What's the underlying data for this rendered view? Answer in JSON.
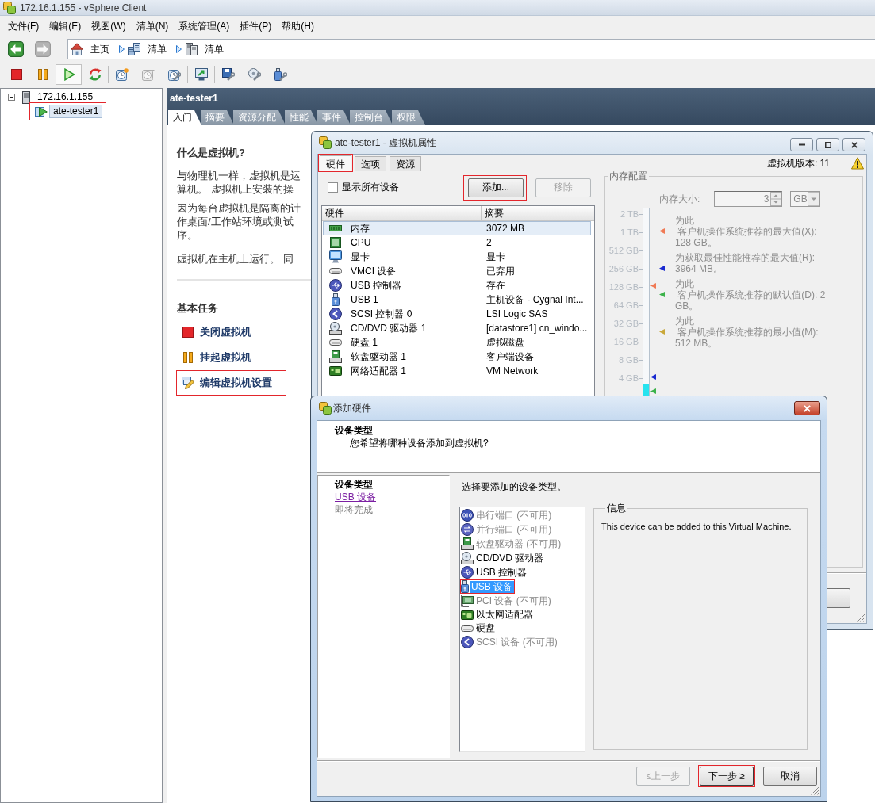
{
  "window": {
    "title": "172.16.1.155 - vSphere Client"
  },
  "menu": [
    "文件(F)",
    "编辑(E)",
    "视图(W)",
    "清单(N)",
    "系统管理(A)",
    "插件(P)",
    "帮助(H)"
  ],
  "navigation": {
    "back": {
      "disabled": false
    },
    "forward": {
      "disabled": true
    },
    "breadcrumbs": [
      {
        "kind": "home",
        "label": "主页"
      },
      {
        "kind": "inventory",
        "label": "清单"
      },
      {
        "kind": "hosts",
        "label": "清单"
      }
    ]
  },
  "toolbar": [
    [
      {
        "kind": "stop",
        "disabled": false,
        "pressed": false
      },
      {
        "kind": "pause",
        "disabled": false,
        "pressed": false
      },
      {
        "kind": "play",
        "disabled": false,
        "pressed": true
      },
      {
        "kind": "reset",
        "disabled": false,
        "pressed": false
      }
    ],
    [
      {
        "kind": "snapshot",
        "disabled": false,
        "pressed": false
      },
      {
        "kind": "revert",
        "disabled": true,
        "pressed": false
      },
      {
        "kind": "snapshot_manager",
        "disabled": false,
        "pressed": false
      }
    ],
    [
      {
        "kind": "console",
        "disabled": false,
        "pressed": false
      }
    ],
    [
      {
        "kind": "edit_settings",
        "disabled": false,
        "pressed": false
      },
      {
        "kind": "cd_settings",
        "disabled": false,
        "pressed": false
      },
      {
        "kind": "usb_settings",
        "disabled": false,
        "pressed": false
      }
    ]
  ],
  "inventory_tree": [
    {
      "kind": "host",
      "label": "172.16.1.155",
      "expanded": true,
      "selected": false,
      "highlighted": false,
      "children": [
        {
          "kind": "vm",
          "label": "ate-tester1",
          "selected": true,
          "highlighted": true
        }
      ]
    }
  ],
  "vm_panel": {
    "title": "ate-tester1",
    "tabs": [
      {
        "label": "入门",
        "selected": true
      },
      {
        "label": "摘要",
        "selected": false
      },
      {
        "label": "资源分配",
        "selected": false
      },
      {
        "label": "性能",
        "selected": false
      },
      {
        "label": "事件",
        "selected": false
      },
      {
        "label": "控制台",
        "selected": false
      },
      {
        "label": "权限",
        "selected": false
      }
    ],
    "heading": "什么是虚拟机?",
    "paragraphs": [
      [
        "与物理机一样，虚拟机是运",
        "算机。 虚拟机上安装的操"
      ],
      [
        "因为每台虚拟机是隔离的计",
        "作桌面/工作站环境或测试",
        "序。"
      ],
      [
        "虚拟机在主机上运行。 同"
      ]
    ],
    "tasks_heading": "基本任务",
    "tasks": [
      {
        "kind": "power_off",
        "label": "关闭虚拟机",
        "highlighted": false
      },
      {
        "kind": "suspend",
        "label": "挂起虚拟机",
        "highlighted": false
      },
      {
        "kind": "edit",
        "label": "编辑虚拟机设置",
        "highlighted": true
      }
    ]
  },
  "properties_dialog": {
    "title": "ate-tester1 - 虚拟机属性",
    "tabs": [
      {
        "label": "硬件",
        "selected": true,
        "highlighted": true
      },
      {
        "label": "选项",
        "selected": false,
        "highlighted": false
      },
      {
        "label": "资源",
        "selected": false,
        "highlighted": false
      }
    ],
    "version": "虚拟机版本: 11",
    "warning": true,
    "show_all_devices": {
      "label": "显示所有设备",
      "checked": false
    },
    "buttons": [
      {
        "label": "添加...",
        "disabled": false,
        "highlighted": true
      },
      {
        "label": "移除",
        "disabled": true,
        "highlighted": false
      }
    ],
    "table": {
      "columns": [
        "硬件",
        "摘要"
      ],
      "rows": [
        {
          "kind": "memory",
          "name": "内存",
          "summary": "3072 MB",
          "selected": true
        },
        {
          "kind": "cpu",
          "name": "CPU",
          "summary": "2",
          "selected": false
        },
        {
          "kind": "display",
          "name": "显卡",
          "summary": "显卡",
          "selected": false
        },
        {
          "kind": "vmci",
          "name": "VMCI 设备",
          "summary": "已弃用",
          "selected": false
        },
        {
          "kind": "usb_controller",
          "name": "USB 控制器",
          "summary": "存在",
          "selected": false
        },
        {
          "kind": "usb",
          "name": "USB 1",
          "summary": "主机设备 - Cygnal Int...",
          "selected": false
        },
        {
          "kind": "scsi",
          "name": "SCSI 控制器 0",
          "summary": "LSI Logic SAS",
          "selected": false
        },
        {
          "kind": "cdrom",
          "name": "CD/DVD 驱动器 1",
          "summary": "[datastore1] cn_windo...",
          "selected": false
        },
        {
          "kind": "disk",
          "name": "硬盘 1",
          "summary": "虚拟磁盘",
          "selected": false
        },
        {
          "kind": "floppy",
          "name": "软盘驱动器 1",
          "summary": "客户端设备",
          "selected": false
        },
        {
          "kind": "network",
          "name": "网络适配器 1",
          "summary": "VM Network",
          "selected": false
        }
      ]
    },
    "memory": {
      "title": "内存配置",
      "disabled": true,
      "size_label": "内存大小:",
      "size_value": "3",
      "unit": "GB",
      "level": 0.5,
      "ticks": [
        "2 TB",
        "1 TB",
        "512 GB",
        "256 GB",
        "128 GB",
        "64 GB",
        "32 GB",
        "16 GB",
        "8 GB",
        "4 GB"
      ],
      "scale_markers": [
        {
          "color": "#f07a55",
          "level": 0.78
        },
        {
          "color": "#1a2ad0",
          "level": 0.52
        },
        {
          "color": "#3cb24a",
          "level": 0.48
        }
      ],
      "legend": [
        {
          "color": "#f07a55",
          "lines": [
            "为此",
            " 客户机操作系统推荐的最大值(X):",
            "128 GB。"
          ]
        },
        {
          "color": "#1a2ad0",
          "lines": [
            "为获取最佳性能推荐的最大值(R):",
            "3964 MB。"
          ]
        },
        {
          "color": "#3cb24a",
          "lines": [
            "为此",
            " 客户机操作系统推荐的默认值(D): 2",
            "GB。"
          ]
        },
        {
          "color": "#c9a83a",
          "lines": [
            "为此",
            " 客户机操作系统推荐的最小值(M):",
            "512 MB。"
          ]
        }
      ]
    }
  },
  "add_hardware_dialog": {
    "title": "添加硬件",
    "heading": "设备类型",
    "subtitle": "您希望将哪种设备添加到虚拟机?",
    "steps": [
      {
        "label": "设备类型",
        "selected": true,
        "disabled": false
      },
      {
        "label": "USB 设备",
        "selected": false,
        "disabled": false
      },
      {
        "label": "即将完成",
        "selected": false,
        "disabled": true
      }
    ],
    "prompt": "选择要添加的设备类型。",
    "devices": [
      {
        "kind": "serial",
        "label": "串行端口 (不可用)",
        "disabled": true,
        "selected": false,
        "highlighted": false
      },
      {
        "kind": "parallel",
        "label": "并行端口 (不可用)",
        "disabled": true,
        "selected": false,
        "highlighted": false
      },
      {
        "kind": "floppy",
        "label": "软盘驱动器 (不可用)",
        "disabled": true,
        "selected": false,
        "highlighted": false
      },
      {
        "kind": "cdrom",
        "label": "CD/DVD 驱动器",
        "disabled": false,
        "selected": false,
        "highlighted": false
      },
      {
        "kind": "usb_controller",
        "label": "USB 控制器",
        "disabled": false,
        "selected": false,
        "highlighted": false
      },
      {
        "kind": "usb",
        "label": "USB 设备",
        "disabled": false,
        "selected": true,
        "highlighted": true
      },
      {
        "kind": "pci",
        "label": "PCI 设备 (不可用)",
        "disabled": true,
        "selected": false,
        "highlighted": false
      },
      {
        "kind": "network",
        "label": "以太网适配器",
        "disabled": false,
        "selected": false,
        "highlighted": false
      },
      {
        "kind": "disk",
        "label": "硬盘",
        "disabled": false,
        "selected": false,
        "highlighted": false
      },
      {
        "kind": "scsi",
        "label": "SCSI 设备 (不可用)",
        "disabled": true,
        "selected": false,
        "highlighted": false
      }
    ],
    "info": {
      "title": "信息",
      "text": "This device can be added to this Virtual Machine."
    },
    "buttons": [
      {
        "label": "≤上一步",
        "disabled": true,
        "default": false,
        "highlighted": false
      },
      {
        "label": "下一步 ≥",
        "disabled": false,
        "default": true,
        "highlighted": true
      },
      {
        "label": "取消",
        "disabled": false,
        "default": false,
        "highlighted": false
      }
    ]
  }
}
